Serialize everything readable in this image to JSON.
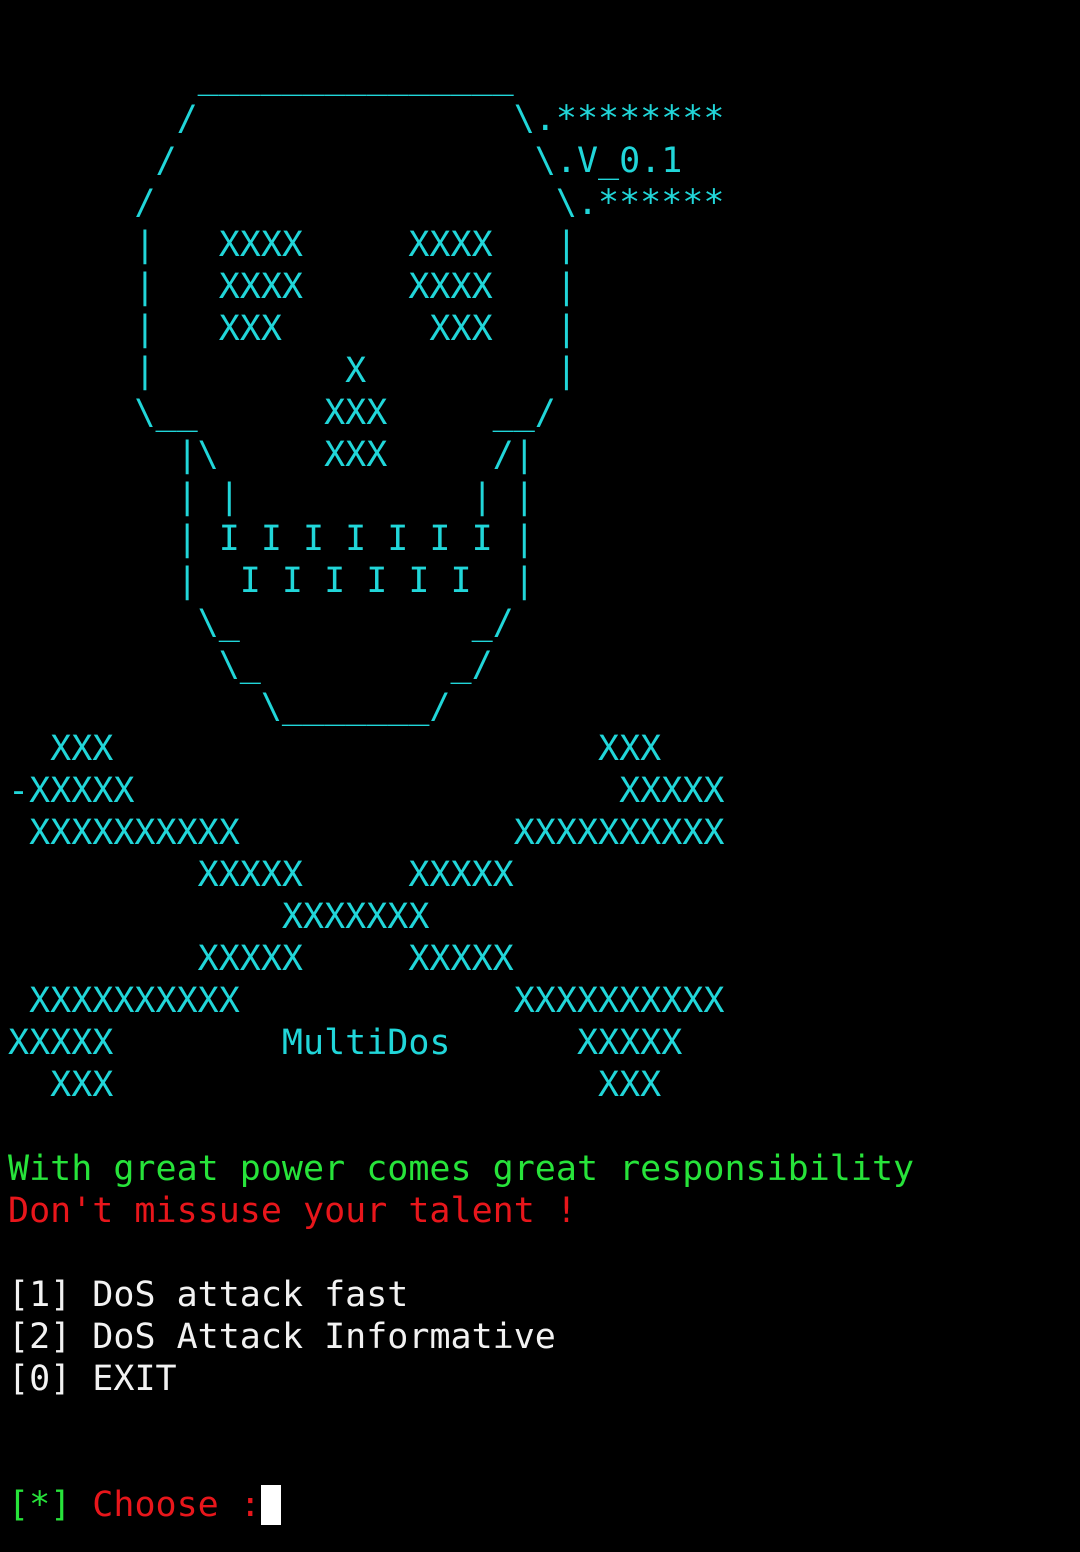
{
  "ascii_art": {
    "lines": [
      "         _______________",
      "        /               \\.********",
      "       /                 \\.V_0.1",
      "      /                   \\.******",
      "      |   XXXX     XXXX   |",
      "      |   XXXX     XXXX   |",
      "      |   XXX       XXX   |",
      "      |         X         |",
      "      \\__      XXX     __/",
      "        |\\     XXX     /|",
      "        | |           | |",
      "        | I I I I I I I |",
      "        |  I I I I I I  |",
      "         \\_           _/",
      "          \\_         _/",
      "            \\_______/",
      "  XXX                       XXX",
      "-XXXXX                       XXXXX",
      " XXXXXXXXXX             XXXXXXXXXX",
      "         XXXXX     XXXXX",
      "             XXXXXXX",
      "         XXXXX     XXXXX",
      " XXXXXXXXXX             XXXXXXXXXX",
      "XXXXX        MultiDos      XXXXX",
      "  XXX                       XXX"
    ]
  },
  "messages": {
    "tagline": "With great power comes great responsibility",
    "warning": "Don't missuse your talent !"
  },
  "menu": {
    "items": [
      {
        "key": "[1]",
        "label": "DoS attack fast"
      },
      {
        "key": "[2]",
        "label": "DoS Attack Informative"
      },
      {
        "key": "[0]",
        "label": "EXIT"
      }
    ]
  },
  "prompt": {
    "marker": "[*]",
    "label": "Choose :"
  },
  "colors": {
    "art": "#21d6d9",
    "tagline": "#27e33a",
    "warning": "#e8161b",
    "menu": "#f2f2f2",
    "background": "#000000"
  }
}
